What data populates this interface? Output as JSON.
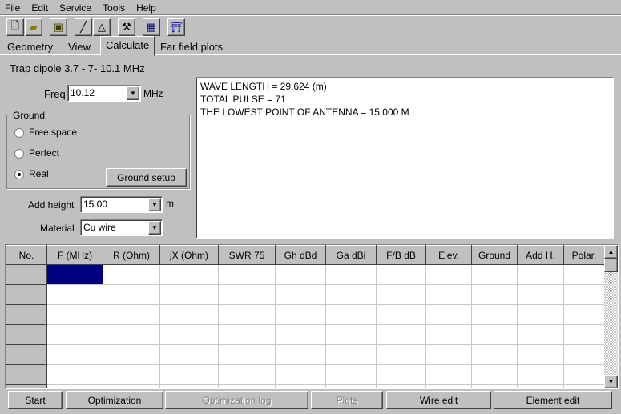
{
  "menu": [
    "File",
    "Edit",
    "Service",
    "Tools",
    "Help"
  ],
  "toolbar": [
    "new-file",
    "open-folder",
    "save-disk",
    "wire-line",
    "triangle",
    "tools",
    "calculator",
    "antenna-run"
  ],
  "tabs": [
    "Geometry",
    "View",
    "Calculate",
    "Far field plots"
  ],
  "active_tab": "Calculate",
  "project_title": "Trap dipole 3.7 - 7- 10.1 MHz",
  "freq": {
    "label": "Freq",
    "value": "10.12",
    "unit": "MHz"
  },
  "ground": {
    "label": "Ground",
    "options": [
      "Free space",
      "Perfect",
      "Real"
    ],
    "selected": "Real",
    "setup_button": "Ground setup"
  },
  "add_height": {
    "label": "Add height",
    "value": "15.00",
    "unit": "m"
  },
  "material": {
    "label": "Material",
    "value": "Cu wire"
  },
  "output": [
    "WAVE LENGTH = 29.624 (m)",
    "TOTAL PULSE = 71",
    "THE LOWEST POINT OF ANTENNA = 15.000 M"
  ],
  "grid": {
    "columns": [
      "No.",
      "F (MHz)",
      "R (Ohm)",
      "jX (Ohm)",
      "SWR 75",
      "Gh dBd",
      "Ga dBi",
      "F/B dB",
      "Elev.",
      "Ground",
      "Add H.",
      "Polar."
    ],
    "selection_color": "#000080"
  },
  "buttons": {
    "start": "Start",
    "optimization": "Optimization",
    "optimization_log": "Optimization log",
    "plots": "Plots",
    "wire_edit": "Wire edit",
    "element_edit": "Element edit"
  }
}
